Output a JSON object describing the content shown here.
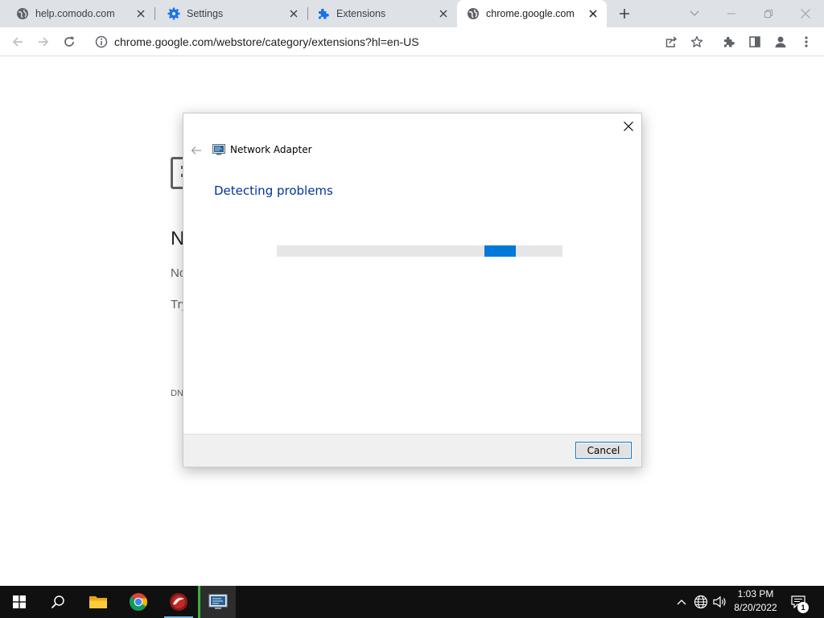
{
  "browser": {
    "tabs": [
      {
        "title": "help.comodo.com",
        "icon": "globe-icon",
        "active": false
      },
      {
        "title": "Settings",
        "icon": "gear-icon",
        "active": false
      },
      {
        "title": "Extensions",
        "icon": "puzzle-icon",
        "active": false
      },
      {
        "title": "chrome.google.com",
        "icon": "globe-icon",
        "active": true
      }
    ],
    "url": "chrome.google.com/webstore/category/extensions?hl=en-US",
    "accent": "#1a73e8"
  },
  "page_behind": {
    "heading_fragment": "N",
    "line1_fragment": "No",
    "line2_fragment": "Try",
    "code_fragment": "DN"
  },
  "dialog": {
    "app_name": "Network Adapter",
    "heading": "Detecting problems",
    "cancel_label": "Cancel",
    "heading_color": "#003399",
    "progress_color": "#0078d7"
  },
  "taskbar": {
    "apps": [
      "windows-start",
      "search",
      "file-explorer",
      "chrome",
      "comodo-dragon",
      "network-troubleshooter"
    ],
    "time": "1:03 PM",
    "date": "8/20/2022",
    "notification_count": "1"
  }
}
